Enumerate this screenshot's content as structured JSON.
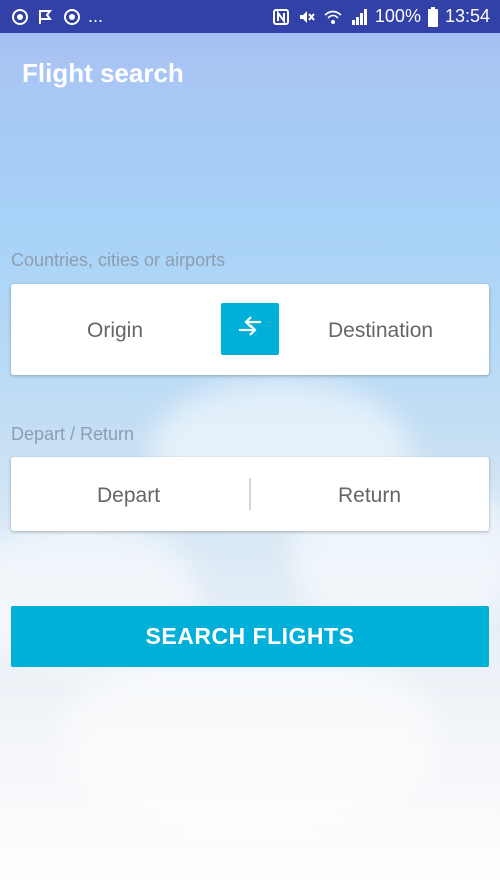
{
  "status_bar": {
    "left_icons": [
      "sync-icon",
      "flag-check-icon",
      "sync-icon"
    ],
    "overflow_text": "...",
    "right_icons": [
      "nfc-icon",
      "mute-icon",
      "wifi-icon",
      "signal-icon"
    ],
    "battery_text": "100%",
    "time": "13:54"
  },
  "header": {
    "title": "Flight search"
  },
  "route": {
    "section_label": "Countries, cities or airports",
    "origin_label": "Origin",
    "destination_label": "Destination",
    "swap_icon": "swap-arrows-icon"
  },
  "dates": {
    "section_label": "Depart / Return",
    "depart_label": "Depart",
    "return_label": "Return"
  },
  "search": {
    "button_label": "SEARCH FLIGHTS"
  },
  "colors": {
    "status_bar": "#3141a7",
    "accent": "#00b0d8",
    "label": "#8c9db0",
    "field_text": "#666666"
  }
}
